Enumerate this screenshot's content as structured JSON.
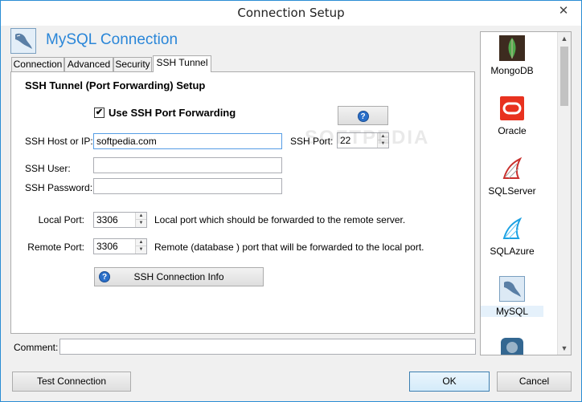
{
  "window": {
    "title": "Connection Setup",
    "close_glyph": "✕"
  },
  "header": {
    "title": "MySQL Connection",
    "icon": "mysql-dolphin-icon"
  },
  "tabs": [
    {
      "label": "Connection"
    },
    {
      "label": "Advanced"
    },
    {
      "label": "Security"
    },
    {
      "label": "SSH Tunnel",
      "active": true
    }
  ],
  "ssh": {
    "section_title": "SSH Tunnel (Port Forwarding) Setup",
    "use_label": "Use  SSH Port Forwarding",
    "use_checked": true,
    "check_glyph": "✔",
    "help_glyph": "?",
    "host_label": "SSH Host or IP:",
    "host_value": "softpedia.com",
    "port_label": "SSH Port:",
    "port_value": "22",
    "user_label": "SSH User:",
    "user_value": "",
    "password_label": "SSH Password:",
    "password_value": "",
    "local_port_label": "Local Port:",
    "local_port_value": "3306",
    "local_port_desc": "Local port which should be forwarded to the remote server.",
    "remote_port_label": "Remote Port:",
    "remote_port_value": "3306",
    "remote_port_desc": "Remote (database ) port that will be forwarded to the local port.",
    "info_button": "SSH Connection Info"
  },
  "watermark": "SOFTPEDIA",
  "databases": [
    {
      "label": "MongoDB",
      "icon": "mongodb-icon"
    },
    {
      "label": "Oracle",
      "icon": "oracle-icon"
    },
    {
      "label": "SQLServer",
      "icon": "sqlserver-icon"
    },
    {
      "label": "SQLAzure",
      "icon": "sqlazure-icon"
    },
    {
      "label": "MySQL",
      "icon": "mysql-icon",
      "selected": true
    },
    {
      "label": "",
      "icon": "postgresql-icon"
    }
  ],
  "scroll": {
    "up": "▲",
    "down": "▼"
  },
  "spin": {
    "up": "▲",
    "down": "▼"
  },
  "comment": {
    "label": "Comment:",
    "value": ""
  },
  "buttons": {
    "test": "Test Connection",
    "ok": "OK",
    "cancel": "Cancel"
  },
  "colors": {
    "accent": "#2a86d8",
    "border": "#acacac"
  }
}
